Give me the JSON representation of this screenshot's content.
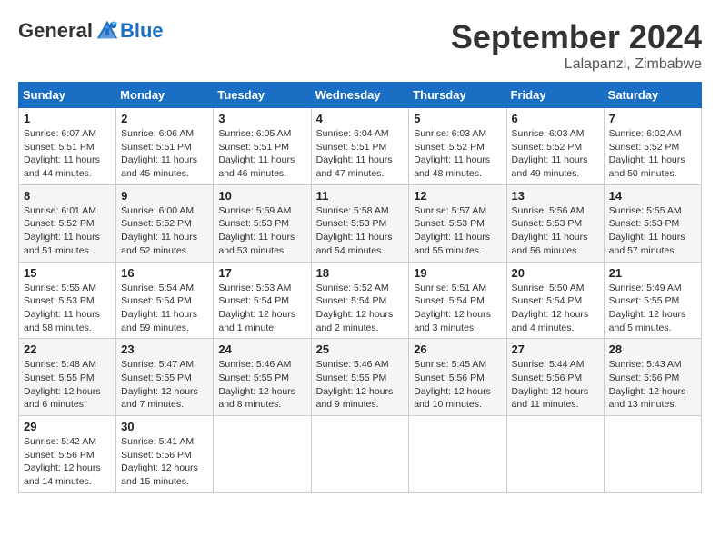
{
  "header": {
    "logo_general": "General",
    "logo_blue": "Blue",
    "month_title": "September 2024",
    "location": "Lalapanzi, Zimbabwe"
  },
  "columns": [
    "Sunday",
    "Monday",
    "Tuesday",
    "Wednesday",
    "Thursday",
    "Friday",
    "Saturday"
  ],
  "weeks": [
    [
      {
        "day": "1",
        "info": "Sunrise: 6:07 AM\nSunset: 5:51 PM\nDaylight: 11 hours and 44 minutes."
      },
      {
        "day": "2",
        "info": "Sunrise: 6:06 AM\nSunset: 5:51 PM\nDaylight: 11 hours and 45 minutes."
      },
      {
        "day": "3",
        "info": "Sunrise: 6:05 AM\nSunset: 5:51 PM\nDaylight: 11 hours and 46 minutes."
      },
      {
        "day": "4",
        "info": "Sunrise: 6:04 AM\nSunset: 5:51 PM\nDaylight: 11 hours and 47 minutes."
      },
      {
        "day": "5",
        "info": "Sunrise: 6:03 AM\nSunset: 5:52 PM\nDaylight: 11 hours and 48 minutes."
      },
      {
        "day": "6",
        "info": "Sunrise: 6:03 AM\nSunset: 5:52 PM\nDaylight: 11 hours and 49 minutes."
      },
      {
        "day": "7",
        "info": "Sunrise: 6:02 AM\nSunset: 5:52 PM\nDaylight: 11 hours and 50 minutes."
      }
    ],
    [
      {
        "day": "8",
        "info": "Sunrise: 6:01 AM\nSunset: 5:52 PM\nDaylight: 11 hours and 51 minutes."
      },
      {
        "day": "9",
        "info": "Sunrise: 6:00 AM\nSunset: 5:52 PM\nDaylight: 11 hours and 52 minutes."
      },
      {
        "day": "10",
        "info": "Sunrise: 5:59 AM\nSunset: 5:53 PM\nDaylight: 11 hours and 53 minutes."
      },
      {
        "day": "11",
        "info": "Sunrise: 5:58 AM\nSunset: 5:53 PM\nDaylight: 11 hours and 54 minutes."
      },
      {
        "day": "12",
        "info": "Sunrise: 5:57 AM\nSunset: 5:53 PM\nDaylight: 11 hours and 55 minutes."
      },
      {
        "day": "13",
        "info": "Sunrise: 5:56 AM\nSunset: 5:53 PM\nDaylight: 11 hours and 56 minutes."
      },
      {
        "day": "14",
        "info": "Sunrise: 5:55 AM\nSunset: 5:53 PM\nDaylight: 11 hours and 57 minutes."
      }
    ],
    [
      {
        "day": "15",
        "info": "Sunrise: 5:55 AM\nSunset: 5:53 PM\nDaylight: 11 hours and 58 minutes."
      },
      {
        "day": "16",
        "info": "Sunrise: 5:54 AM\nSunset: 5:54 PM\nDaylight: 11 hours and 59 minutes."
      },
      {
        "day": "17",
        "info": "Sunrise: 5:53 AM\nSunset: 5:54 PM\nDaylight: 12 hours and 1 minute."
      },
      {
        "day": "18",
        "info": "Sunrise: 5:52 AM\nSunset: 5:54 PM\nDaylight: 12 hours and 2 minutes."
      },
      {
        "day": "19",
        "info": "Sunrise: 5:51 AM\nSunset: 5:54 PM\nDaylight: 12 hours and 3 minutes."
      },
      {
        "day": "20",
        "info": "Sunrise: 5:50 AM\nSunset: 5:54 PM\nDaylight: 12 hours and 4 minutes."
      },
      {
        "day": "21",
        "info": "Sunrise: 5:49 AM\nSunset: 5:55 PM\nDaylight: 12 hours and 5 minutes."
      }
    ],
    [
      {
        "day": "22",
        "info": "Sunrise: 5:48 AM\nSunset: 5:55 PM\nDaylight: 12 hours and 6 minutes."
      },
      {
        "day": "23",
        "info": "Sunrise: 5:47 AM\nSunset: 5:55 PM\nDaylight: 12 hours and 7 minutes."
      },
      {
        "day": "24",
        "info": "Sunrise: 5:46 AM\nSunset: 5:55 PM\nDaylight: 12 hours and 8 minutes."
      },
      {
        "day": "25",
        "info": "Sunrise: 5:46 AM\nSunset: 5:55 PM\nDaylight: 12 hours and 9 minutes."
      },
      {
        "day": "26",
        "info": "Sunrise: 5:45 AM\nSunset: 5:56 PM\nDaylight: 12 hours and 10 minutes."
      },
      {
        "day": "27",
        "info": "Sunrise: 5:44 AM\nSunset: 5:56 PM\nDaylight: 12 hours and 11 minutes."
      },
      {
        "day": "28",
        "info": "Sunrise: 5:43 AM\nSunset: 5:56 PM\nDaylight: 12 hours and 13 minutes."
      }
    ],
    [
      {
        "day": "29",
        "info": "Sunrise: 5:42 AM\nSunset: 5:56 PM\nDaylight: 12 hours and 14 minutes."
      },
      {
        "day": "30",
        "info": "Sunrise: 5:41 AM\nSunset: 5:56 PM\nDaylight: 12 hours and 15 minutes."
      },
      null,
      null,
      null,
      null,
      null
    ]
  ]
}
